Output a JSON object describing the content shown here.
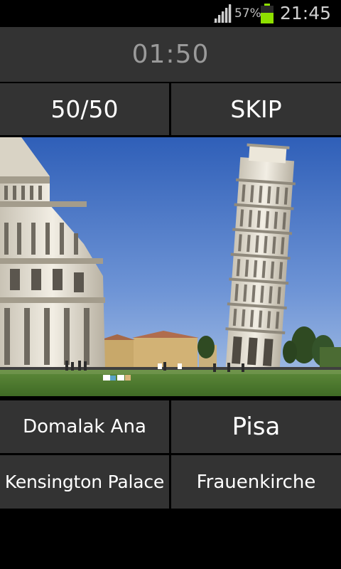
{
  "status_bar": {
    "battery_percent": "57%",
    "time": "21:45",
    "icons": [
      "signal-icon",
      "battery-icon"
    ],
    "battery_color": "#8ee000"
  },
  "timer": {
    "value": "01:50"
  },
  "lifelines": {
    "fifty_fifty_label": "50/50",
    "skip_label": "SKIP"
  },
  "photo": {
    "subject": "landmark-photo"
  },
  "answers": [
    {
      "label": "Domalak Ana"
    },
    {
      "label": "Pisa"
    },
    {
      "label": "Kensington Palace"
    },
    {
      "label": "Frauenkirche"
    }
  ],
  "colors": {
    "button_bg": "#333333",
    "divider": "#000000",
    "timer_text": "#9a9a9a",
    "button_text": "#ffffff"
  }
}
